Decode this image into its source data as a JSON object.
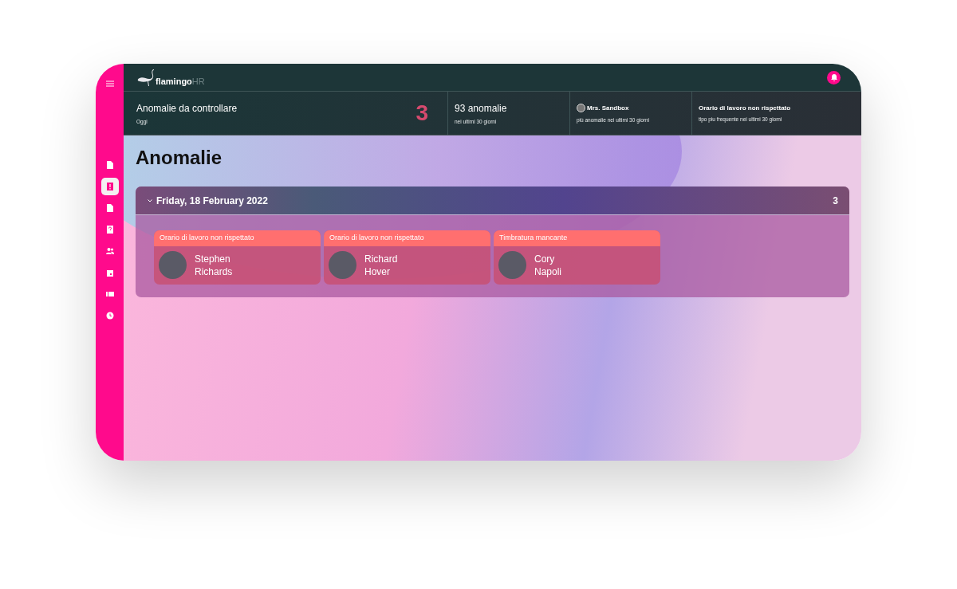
{
  "sidebar": {
    "items": [
      {
        "kind": "document",
        "selected": false
      },
      {
        "kind": "alert",
        "selected": true
      },
      {
        "kind": "page",
        "selected": false
      },
      {
        "kind": "help",
        "selected": false
      },
      {
        "kind": "people",
        "selected": false
      },
      {
        "kind": "calendar",
        "selected": false
      },
      {
        "kind": "list",
        "selected": false
      },
      {
        "kind": "clock",
        "selected": false
      }
    ]
  },
  "header": {
    "logo": {
      "name": "flamingo",
      "suffix": "HR"
    }
  },
  "stats": [
    {
      "kind": "counter",
      "title": "Anomalie da controllare",
      "subtitle": "Oggi",
      "value": "3"
    },
    {
      "kind": "plain",
      "title": "93 anomalie",
      "subtitle": "nei ultimi 30 giorni"
    },
    {
      "kind": "person",
      "title": "Mrs. Sandbox",
      "subtitle": "più anomalie nei ultimi 30 giorni"
    },
    {
      "kind": "bold",
      "title": "Orario di lavoro non rispettato",
      "subtitle": "tipo piu frequente nei ultimi 30 giorni"
    }
  ],
  "page_title": "Anomalie",
  "groups": [
    {
      "date": "Friday, 18 February 2022",
      "count": "3",
      "expanded": true,
      "cards": [
        {
          "type": "Orario di lavoro non rispettato",
          "first_name": "Stephen",
          "last_name": "Richards"
        },
        {
          "type": "Orario di lavoro non rispettato",
          "first_name": "Richard",
          "last_name": "Hover"
        },
        {
          "type": "Timbratura mancante",
          "first_name": "Cory",
          "last_name": "Napoli"
        }
      ]
    }
  ]
}
